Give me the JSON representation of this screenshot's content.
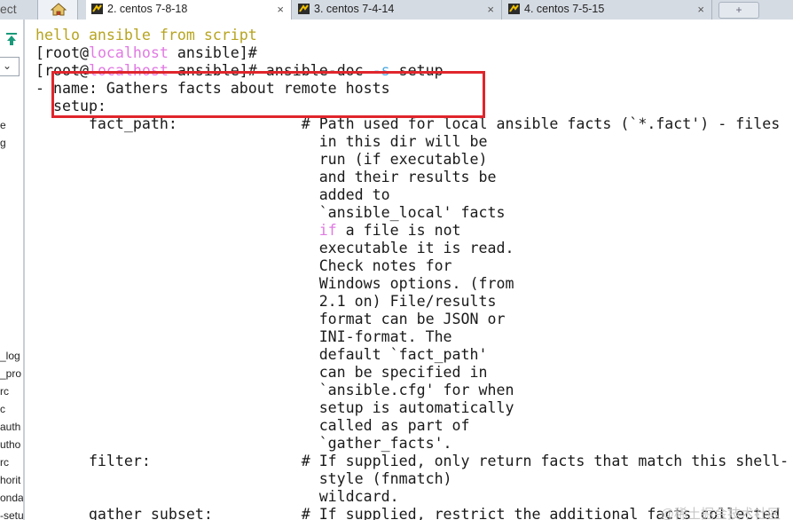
{
  "tabbar": {
    "left_clip": "ect",
    "tabs": [
      {
        "label": "2. centos 7-8-18",
        "active": true
      },
      {
        "label": "3. centos 7-4-14",
        "active": false
      },
      {
        "label": "4. centos 7-5-15",
        "active": false
      }
    ],
    "close_glyph": "×",
    "new_tab_glyph": "+"
  },
  "side_panel": {
    "fragments": [
      "e",
      "g",
      "_log",
      "_pro",
      "rc",
      "c",
      "auth",
      "utho",
      "rc",
      "horit",
      "onda",
      "-setu"
    ]
  },
  "terminal": {
    "lines": [
      {
        "parts": [
          {
            "t": "hello ansible from script",
            "c": "yellow"
          }
        ]
      },
      {
        "parts": [
          {
            "t": "[root@"
          },
          {
            "t": "localhost",
            "c": "pink"
          },
          {
            "t": " ansible]#"
          }
        ]
      },
      {
        "parts": [
          {
            "t": "[root@"
          },
          {
            "t": "localhost",
            "c": "pink"
          },
          {
            "t": " ansible]# ansible-doc "
          },
          {
            "t": "-s",
            "c": "cyan"
          },
          {
            "t": " setup"
          }
        ]
      },
      {
        "parts": [
          {
            "t": "- name: Gathers facts about remote hosts"
          }
        ]
      },
      {
        "parts": [
          {
            "t": "  setup:"
          }
        ]
      },
      {
        "parts": [
          {
            "t": "      fact_path:              # Path used for local ansible facts (`*.fact') - files"
          }
        ]
      },
      {
        "parts": [
          {
            "t": "                                in this dir will be"
          }
        ]
      },
      {
        "parts": [
          {
            "t": "                                run (if executable)"
          }
        ]
      },
      {
        "parts": [
          {
            "t": "                                and their results be"
          }
        ]
      },
      {
        "parts": [
          {
            "t": "                                added to"
          }
        ]
      },
      {
        "parts": [
          {
            "t": "                                `ansible_local' facts"
          }
        ]
      },
      {
        "parts": [
          {
            "t": "                                "
          },
          {
            "t": "if",
            "c": "pink"
          },
          {
            "t": " a file is not"
          }
        ]
      },
      {
        "parts": [
          {
            "t": "                                executable it is read."
          }
        ]
      },
      {
        "parts": [
          {
            "t": "                                Check notes for"
          }
        ]
      },
      {
        "parts": [
          {
            "t": "                                Windows options. (from"
          }
        ]
      },
      {
        "parts": [
          {
            "t": "                                2.1 on) File/results"
          }
        ]
      },
      {
        "parts": [
          {
            "t": "                                format can be JSON or"
          }
        ]
      },
      {
        "parts": [
          {
            "t": "                                INI-format. The"
          }
        ]
      },
      {
        "parts": [
          {
            "t": "                                default `fact_path'"
          }
        ]
      },
      {
        "parts": [
          {
            "t": "                                can be specified in"
          }
        ]
      },
      {
        "parts": [
          {
            "t": "                                `ansible.cfg' for when"
          }
        ]
      },
      {
        "parts": [
          {
            "t": "                                setup is automatically"
          }
        ]
      },
      {
        "parts": [
          {
            "t": "                                called as part of"
          }
        ]
      },
      {
        "parts": [
          {
            "t": "                                `gather_facts'."
          }
        ]
      },
      {
        "parts": [
          {
            "t": "      filter:                 # If supplied, only return facts that match this shell-"
          }
        ]
      },
      {
        "parts": [
          {
            "t": "                                style (fnmatch)"
          }
        ]
      },
      {
        "parts": [
          {
            "t": "                                wildcard."
          }
        ]
      },
      {
        "parts": [
          {
            "t": "      gather_subset:          # If supplied, restrict the additional facts collected"
          }
        ]
      }
    ]
  },
  "watermark": "@稀土掘金技术社区",
  "colors": {
    "yellow": "#b7a420",
    "pink": "#e17ae3",
    "cyan": "#4aa8e0",
    "highlight_box": "#e0252c"
  }
}
